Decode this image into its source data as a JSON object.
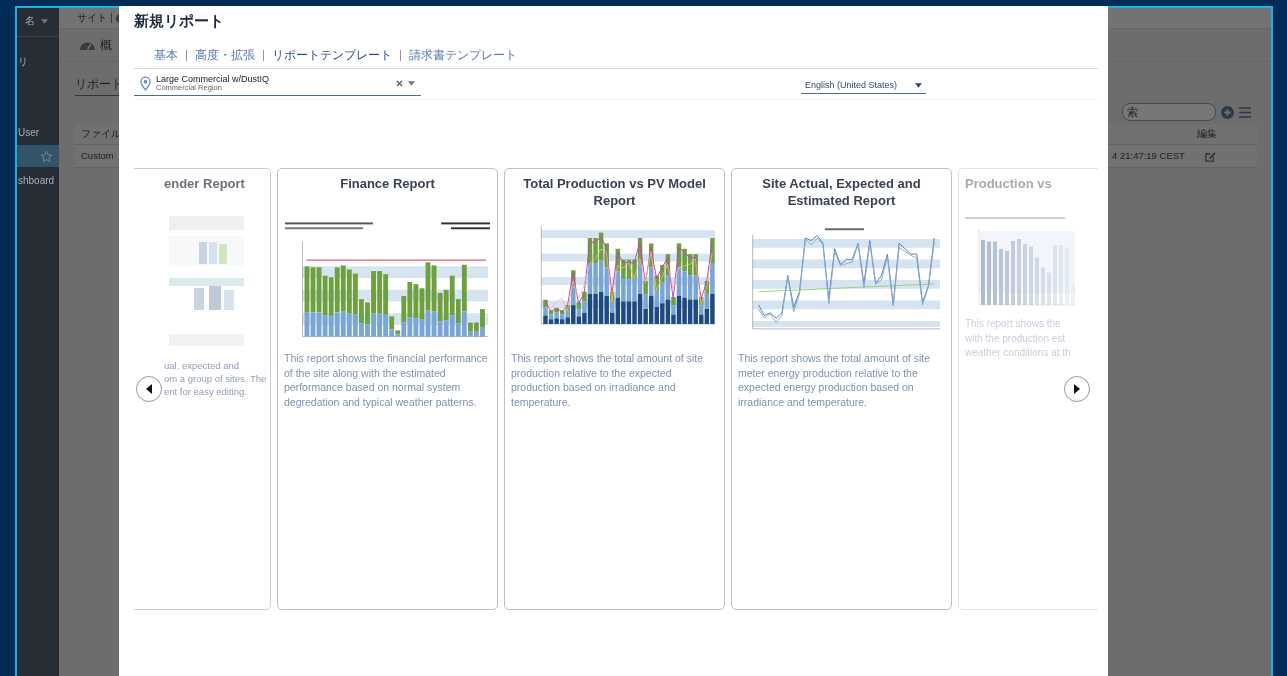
{
  "background_app": {
    "sidebar": {
      "header": "名",
      "items": [
        {
          "kind": "text",
          "label": "リ",
          "selected": false
        },
        {
          "kind": "text",
          "label": "User",
          "selected": false
        },
        {
          "kind": "star",
          "selected": true
        },
        {
          "kind": "text",
          "label": "shboard",
          "selected": false
        }
      ]
    },
    "site_label": "サイト",
    "overview": "概",
    "page_tab": "リポート",
    "search": {
      "placeholder": "索"
    },
    "table": {
      "columns": [
        "ファイル",
        "編集"
      ],
      "rows": [
        {
          "file": "Custom",
          "date": "4 21:47:19 CEST"
        }
      ]
    }
  },
  "modal": {
    "title": "新規リポート",
    "tabs": [
      {
        "label": "基本",
        "selected": false
      },
      {
        "label": "高度・拡張",
        "selected": false
      },
      {
        "label": "リポートテンプレート",
        "selected": true
      },
      {
        "label": "請求書テンプレート",
        "selected": false
      }
    ],
    "site_selector": {
      "name": "Large Commercial w/DustIQ",
      "region": "Commercial Region"
    },
    "language": {
      "value": "English (United States)"
    },
    "cards": [
      {
        "kind": "partial-left",
        "title": "ender Report",
        "thumbnail": {
          "kind": "document"
        },
        "description_lines": [
          "ual, expected and",
          "om a group of sites. The",
          "ent for easy editing."
        ]
      },
      {
        "kind": "full",
        "title": "Finance Report",
        "thumbnail": {
          "kind": "finance-bars"
        },
        "description": "This report shows the financial performance of the site along with the estimated performance based on normal system degredation and typical weather patterns."
      },
      {
        "kind": "full",
        "title": "Total Production vs PV Model Report",
        "thumbnail": {
          "kind": "production-bars"
        },
        "description": "This report shows the total amount of site production relative to the expected production based on irradiance and temperature."
      },
      {
        "kind": "full",
        "title": "Site Actual, Expected and Estimated Report",
        "thumbnail": {
          "kind": "lines"
        },
        "description": "This report shows the total amount of site meter energy production relative to the expected energy production based on irradiance and temperature."
      },
      {
        "kind": "partial-right",
        "title": "Production vs",
        "thumbnail": {
          "kind": "simple-bars"
        },
        "description_lines": [
          "This report shows the",
          "with the production est",
          "weather conditions at th"
        ]
      }
    ]
  }
}
